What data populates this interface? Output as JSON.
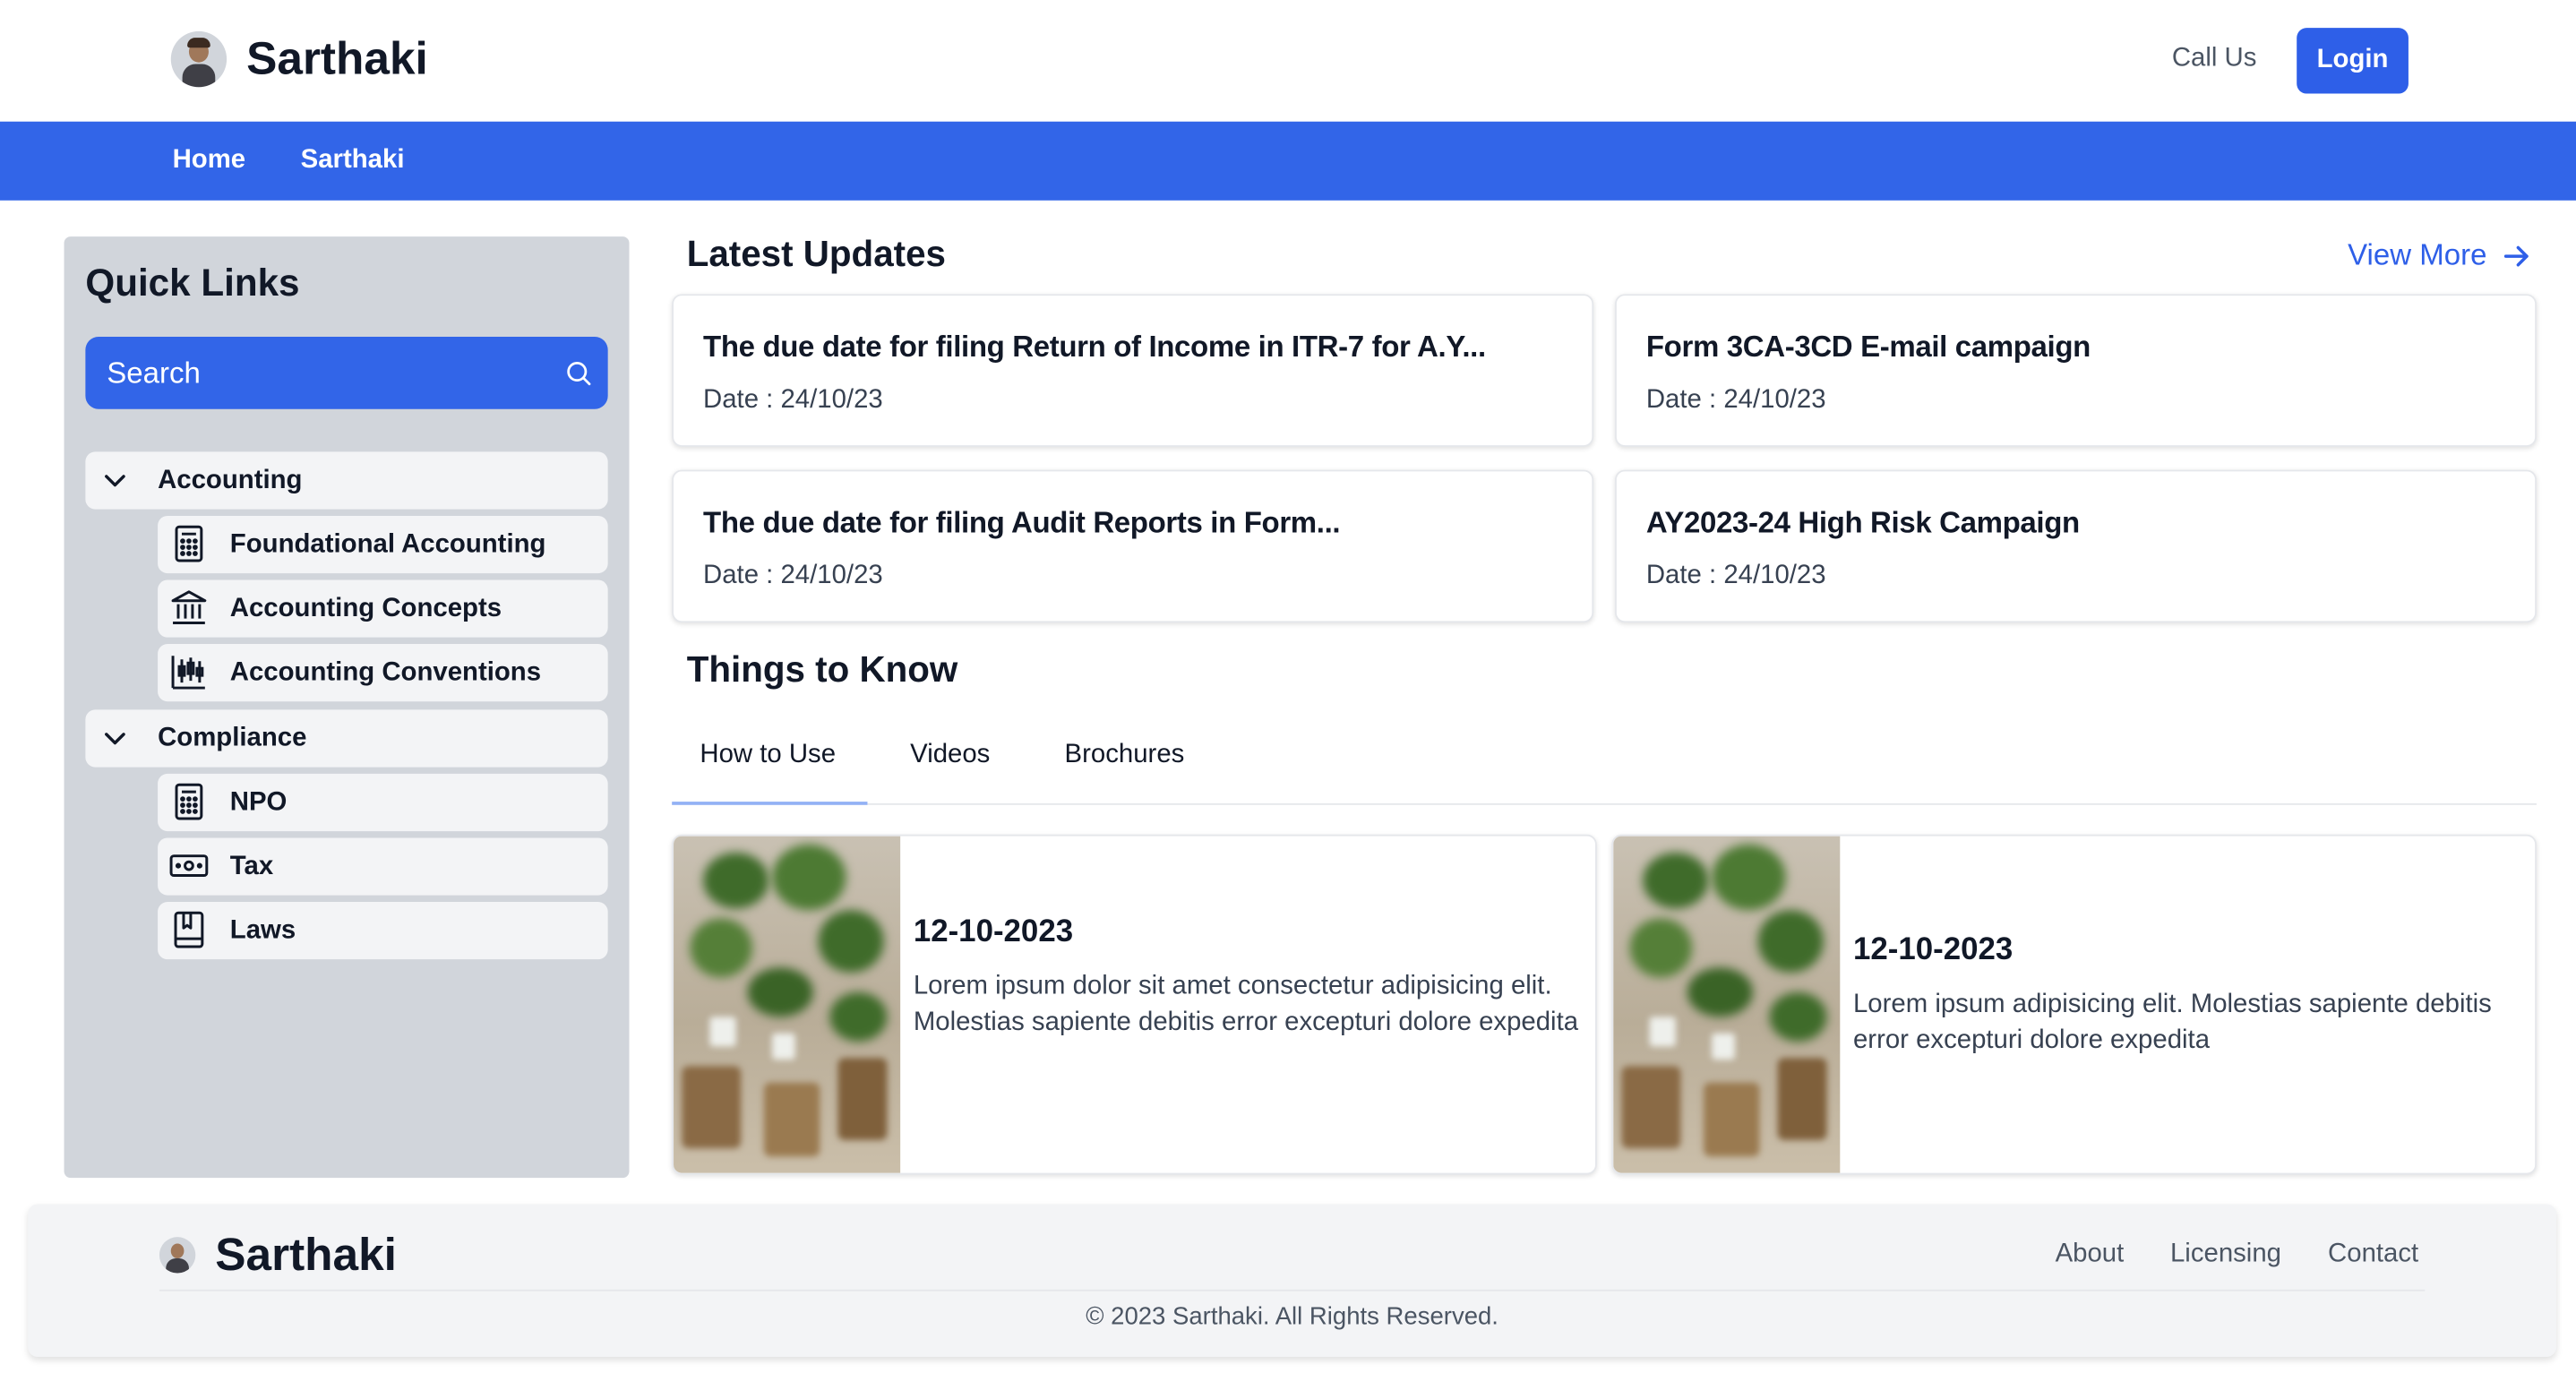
{
  "header": {
    "brand": "Sarthaki",
    "call_us": "Call Us",
    "login": "Login"
  },
  "nav": {
    "items": [
      "Home",
      "Sarthaki"
    ]
  },
  "sidebar": {
    "title": "Quick Links",
    "search_placeholder": "Search",
    "groups": [
      {
        "label": "Accounting",
        "items": [
          {
            "label": "Foundational Accounting",
            "icon": "calculator-icon"
          },
          {
            "label": "Accounting Concepts",
            "icon": "bank-icon"
          },
          {
            "label": "Accounting Conventions",
            "icon": "candlestick-chart-icon"
          }
        ]
      },
      {
        "label": "Compliance",
        "items": [
          {
            "label": "NPO",
            "icon": "calculator-icon"
          },
          {
            "label": "Tax",
            "icon": "cash-icon"
          },
          {
            "label": "Laws",
            "icon": "book-icon"
          }
        ]
      }
    ]
  },
  "latest_updates": {
    "title": "Latest Updates",
    "view_more": "View More",
    "cards": [
      {
        "title": "The due date for filing Return of Income in ITR-7 for A.Y...",
        "date": "Date : 24/10/23"
      },
      {
        "title": "Form 3CA-3CD E-mail campaign",
        "date": "Date : 24/10/23"
      },
      {
        "title": "The due date for filing Audit Reports in Form...",
        "date": "Date : 24/10/23"
      },
      {
        "title": "AY2023-24 High Risk Campaign",
        "date": "Date : 24/10/23"
      }
    ]
  },
  "things_to_know": {
    "title": "Things to Know",
    "tabs": [
      "How to Use",
      "Videos",
      "Brochures"
    ],
    "active_tab": "How to Use",
    "items": [
      {
        "date": "12-10-2023",
        "text": "Lorem ipsum dolor sit amet consectetur adipisicing elit. Molestias sapiente debitis error excepturi dolore expedita"
      },
      {
        "date": "12-10-2023",
        "text": "Lorem ipsum adipisicing elit. Molestias sapiente debitis error excepturi dolore expedita"
      }
    ]
  },
  "footer": {
    "brand": "Sarthaki",
    "links": [
      "About",
      "Licensing",
      "Contact"
    ],
    "copyright": "© 2023 Sarthaki. All Rights Reserved."
  },
  "colors": {
    "primary": "#3265e8",
    "sidebar_bg": "#d1d5db",
    "footer_bg": "#f3f4f6"
  }
}
